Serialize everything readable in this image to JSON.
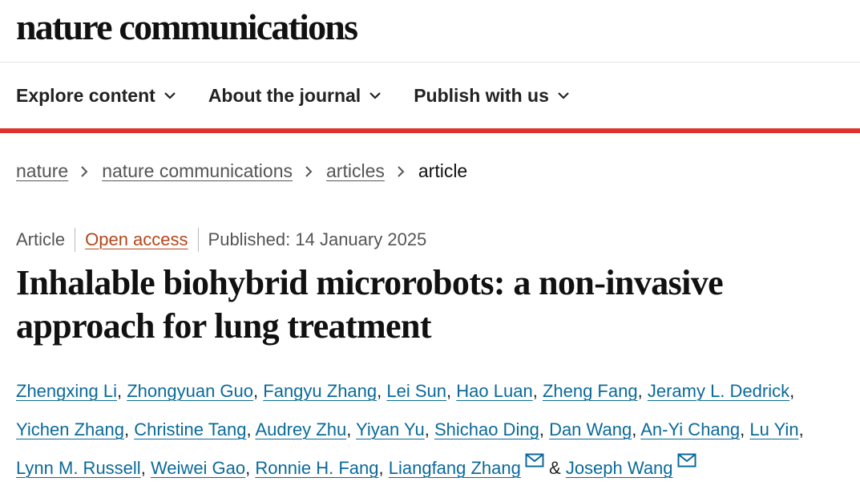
{
  "brand": {
    "logo": "nature communications"
  },
  "nav": {
    "items": [
      {
        "label": "Explore content"
      },
      {
        "label": "About the journal"
      },
      {
        "label": "Publish with us"
      }
    ],
    "accent_color": "#e0322d"
  },
  "breadcrumb": {
    "items": [
      "nature",
      "nature communications",
      "articles"
    ],
    "current": "article"
  },
  "article": {
    "type": "Article",
    "access": "Open access",
    "published": "Published: 14 January 2025",
    "title": "Inhalable biohybrid microrobots: a non-invasive approach for lung treatment",
    "authors": [
      "Zhengxing Li",
      "Zhongyuan Guo",
      "Fangyu Zhang",
      "Lei Sun",
      "Hao Luan",
      "Zheng Fang",
      "Jeramy L. Dedrick",
      "Yichen Zhang",
      "Christine Tang",
      "Audrey Zhu",
      "Yiyan Yu",
      "Shichao Ding",
      "Dan Wang",
      "An-Yi Chang",
      "Lu Yin",
      "Lynn M. Russell",
      "Weiwei Gao",
      "Ronnie H. Fang",
      "Liangfang Zhang",
      "Joseph Wang"
    ],
    "conjunction": "&",
    "link_color": "#0b6a9a",
    "access_color": "#b3471a"
  }
}
